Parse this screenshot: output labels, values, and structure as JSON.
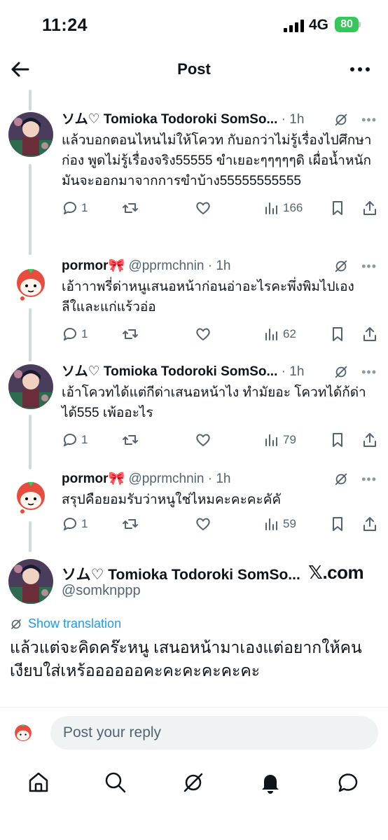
{
  "status_bar": {
    "time": "11:24",
    "network": "4G",
    "battery": "80"
  },
  "header": {
    "title": "Post"
  },
  "tweets": [
    {
      "name": "ソム♡ Tomioka Todoroki SomSo...",
      "handle": "",
      "time": "1h",
      "text": "แล้วบอกตอนไหนไม่ให้โควท กับอกว่าไม่รู้เรื่องไปศึกษาก่อง พูดไม่รู้เรื่องจริง55555 ขำเยอะๆๆๆๆๆดิ เผื่อน้ำหนักมันจะออกมาจากการขำบ้าง55555555555",
      "replies": "1",
      "reposts": "",
      "likes": "",
      "views": "166"
    },
    {
      "name": "pormor🎀",
      "handle": "@pprmchnin",
      "time": "1h",
      "text": "เอ้าาาพรี่ด่าหนูเสนอหน้าก่อนอ่าอะไรคะพึ่งพิมไปเองลีใและแก่แร้วอ่อ",
      "replies": "1",
      "reposts": "",
      "likes": "",
      "views": "62"
    },
    {
      "name": "ソム♡ Tomioka Todoroki SomSo...",
      "handle": "",
      "time": "1h",
      "text": "เอ้าโควทได้แต่กีด่าเสนอหน้าไง ทำมัยอะ โควทได้ก้ด่าได้555 เพ้ออะไร",
      "replies": "1",
      "reposts": "",
      "likes": "",
      "views": "79"
    },
    {
      "name": "pormor🎀",
      "handle": "@pprmchnin",
      "time": "1h",
      "text": "สรุปคือยอมรับว่าหนูใช่ไหมคะคะคะคัคั",
      "replies": "1",
      "reposts": "",
      "likes": "",
      "views": "59"
    }
  ],
  "main_tweet": {
    "name": "ソム♡ Tomioka Todoroki SomSo...",
    "handle": "@somknppp",
    "source": "𝕏.com",
    "show_translation": "Show translation",
    "text": "แล้วแต่จะคิดคร๊ะหนู เสนอหน้ามาเองแต่อยากให้คนเงียบใส่เหร้ออออออคะคะคะคะคะคะ"
  },
  "reply_bar": {
    "placeholder": "Post your reply"
  },
  "nav": [
    "home-icon",
    "search-icon",
    "grok-icon",
    "notifications-icon",
    "messages-icon"
  ],
  "colors": {
    "accent": "#1d9bf0",
    "secondary_text": "#536471",
    "battery": "#34c759"
  }
}
